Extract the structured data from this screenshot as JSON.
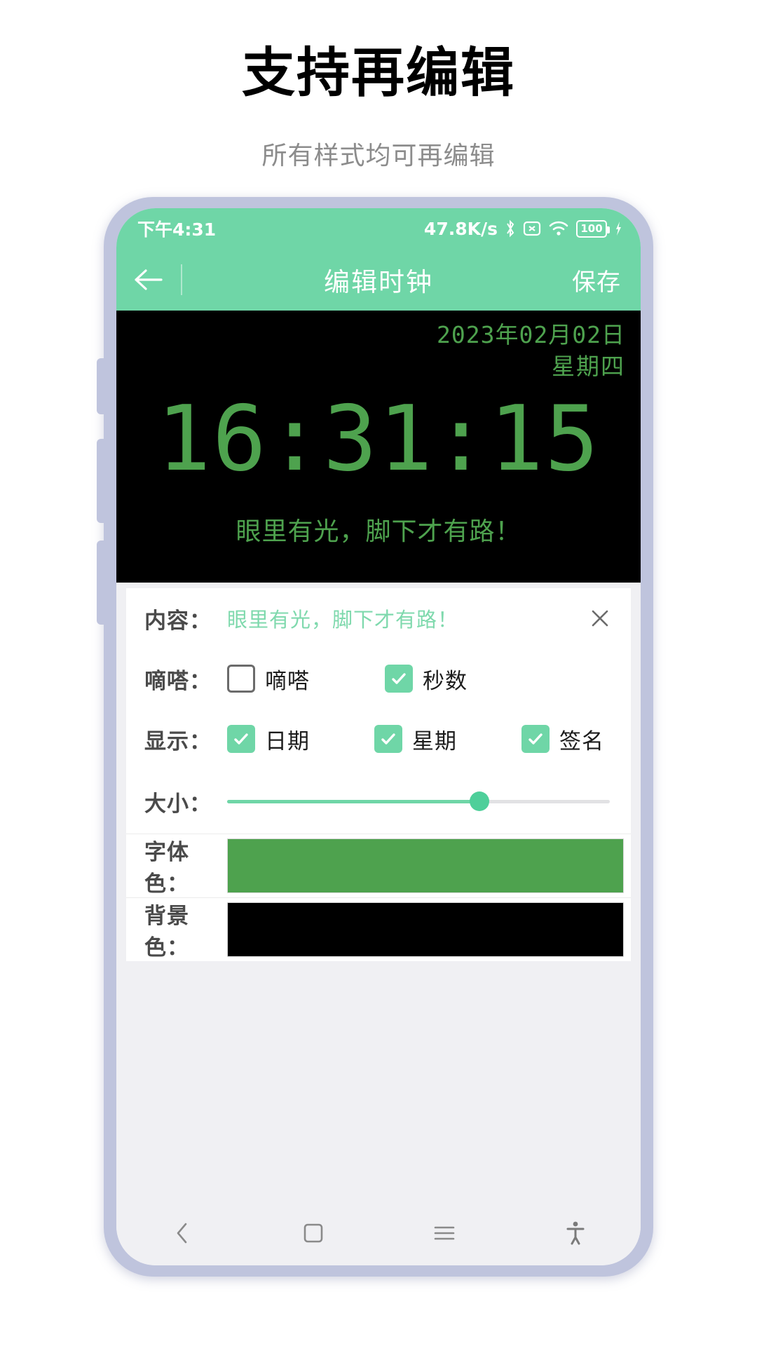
{
  "promo": {
    "title": "支持再编辑",
    "subtitle": "所有样式均可再编辑"
  },
  "status_bar": {
    "time": "下午4:31",
    "net_speed": "47.8K/s",
    "bluetooth_icon": "bluetooth-icon",
    "xbox_icon": "x-box-icon",
    "wifi_icon": "wifi-icon",
    "battery_level": "100",
    "charging_icon": "charging-bolt-icon"
  },
  "app_bar": {
    "back_icon": "back-arrow-icon",
    "title": "编辑时钟",
    "save_label": "保存"
  },
  "clock_preview": {
    "date": "2023年02月02日",
    "weekday": "星期四",
    "time": "16:31:15",
    "signature": "眼里有光，脚下才有路！",
    "font_color": "#4ea24e",
    "background_color": "#000000"
  },
  "settings": {
    "content": {
      "label": "内容：",
      "value": "眼里有光，脚下才有路！",
      "clear_icon": "close-icon"
    },
    "tick": {
      "label": "嘀嗒：",
      "options": [
        {
          "label": "嘀嗒",
          "checked": false
        },
        {
          "label": "秒数",
          "checked": true
        }
      ]
    },
    "display": {
      "label": "显示：",
      "options": [
        {
          "label": "日期",
          "checked": true
        },
        {
          "label": "星期",
          "checked": true
        },
        {
          "label": "签名",
          "checked": true
        }
      ]
    },
    "size": {
      "label": "大小：",
      "percent": 66
    },
    "font_color": {
      "label": "字体色：",
      "color": "#4ea24e"
    },
    "background_color": {
      "label": "背景色：",
      "color": "#000000"
    }
  },
  "nav_bar": {
    "back_icon": "chevron-left-icon",
    "home_icon": "square-home-icon",
    "recents_icon": "hamburger-recents-icon",
    "accessibility_icon": "accessibility-person-icon"
  },
  "theme": {
    "accent": "#6fd6a7",
    "frame": "#bfc4dd",
    "screen_bg": "#f0f0f3",
    "lcd_green": "#4ea24e",
    "value_green": "#7fd9ad"
  }
}
